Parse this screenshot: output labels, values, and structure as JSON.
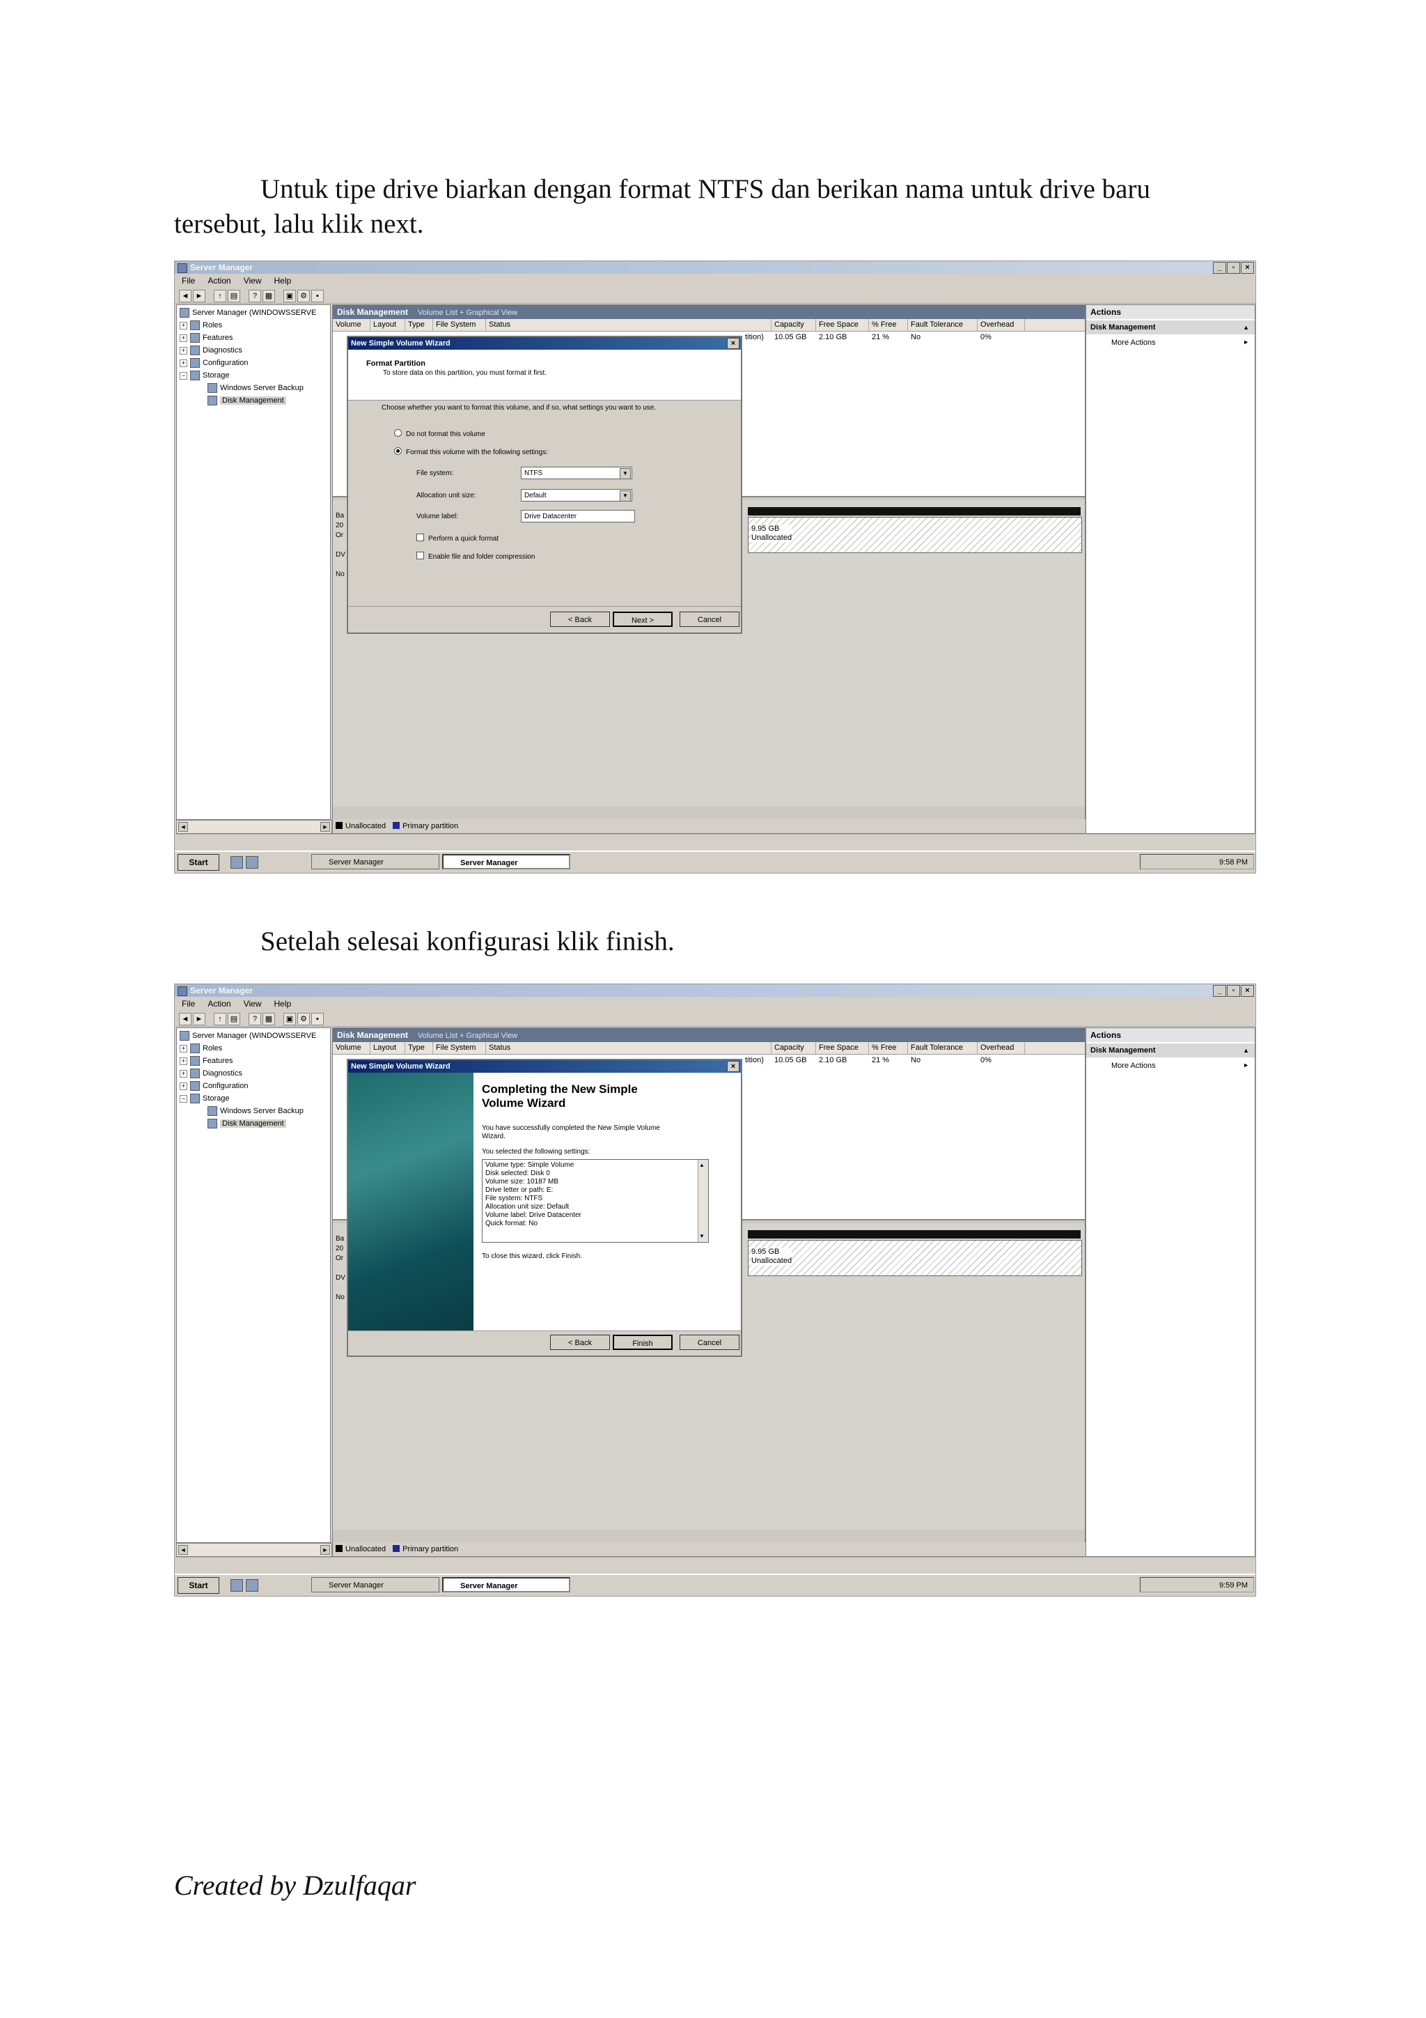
{
  "doc": {
    "para1_line1": "Untuk tipe drive biarkan dengan format NTFS dan berikan nama untuk drive baru",
    "para1_line2": "tersebut, lalu klik next.",
    "para2": "Setelah selesai konfigurasi klik finish.",
    "footer": "Created by Dzulfaqar"
  },
  "window": {
    "title": "Server Manager",
    "menu": [
      "File",
      "Action",
      "View",
      "Help"
    ]
  },
  "tree": {
    "root": "Server Manager (WINDOWSSERVE",
    "roles": "Roles",
    "features": "Features",
    "diagnostics": "Diagnostics",
    "configuration": "Configuration",
    "storage": "Storage",
    "backup": "Windows Server Backup",
    "disk_mgmt": "Disk Management"
  },
  "panel": {
    "title": "Disk Management",
    "subtitle": "Volume List + Graphical View",
    "columns": [
      "Volume",
      "Layout",
      "Type",
      "File System",
      "Status",
      "Capacity",
      "Free Space",
      "% Free",
      "Fault Tolerance",
      "Overhead"
    ],
    "row": {
      "status_tail": "tition)",
      "capacity": "10.05 GB",
      "free": "2.10 GB",
      "pct": "21 %",
      "fault": "No",
      "overhead": "0%"
    },
    "unalloc_size": "9.95 GB",
    "unalloc_label": "Unallocated",
    "left_tags": [
      "Ba",
      "20",
      "Or",
      "",
      "DV",
      "",
      "No"
    ],
    "legend_unalloc": "Unallocated",
    "legend_primary": "Primary partition"
  },
  "actions": {
    "header": "Actions",
    "sub": "Disk Management",
    "more": "More Actions"
  },
  "taskbar": {
    "start": "Start",
    "btn1": "Server Manager",
    "btn2": "Server Manager",
    "time1": "9:58 PM",
    "time2": "9:59 PM"
  },
  "wizard1": {
    "title": "New Simple Volume Wizard",
    "head_title": "Format Partition",
    "head_sub": "To store data on this partition, you must format it first.",
    "intro": "Choose whether you want to format this volume, and if so, what settings you want to use.",
    "opt_no": "Do not format this volume",
    "opt_yes": "Format this volume with the following settings:",
    "fs_label": "File system:",
    "fs_value": "NTFS",
    "au_label": "Allocation unit size:",
    "au_value": "Default",
    "vl_label": "Volume label:",
    "vl_value": "Drive Datacenter",
    "quick": "Perform a quick format",
    "compress": "Enable file and folder compression",
    "back": "< Back",
    "next": "Next >",
    "cancel": "Cancel"
  },
  "wizard2": {
    "title": "New Simple Volume Wizard",
    "heading_l1": "Completing the New Simple",
    "heading_l2": "Volume Wizard",
    "success_l1": "You have successfully completed the New Simple Volume",
    "success_l2": "Wizard.",
    "selected": "You selected the following settings:",
    "settings": [
      "Volume type: Simple Volume",
      "Disk selected: Disk 0",
      "Volume size: 10187 MB",
      "Drive letter or path: E:",
      "File system: NTFS",
      "Allocation unit size: Default",
      "Volume label: Drive Datacenter",
      "Quick format: No"
    ],
    "close": "To close this wizard, click Finish.",
    "back": "< Back",
    "finish": "Finish",
    "cancel": "Cancel"
  }
}
